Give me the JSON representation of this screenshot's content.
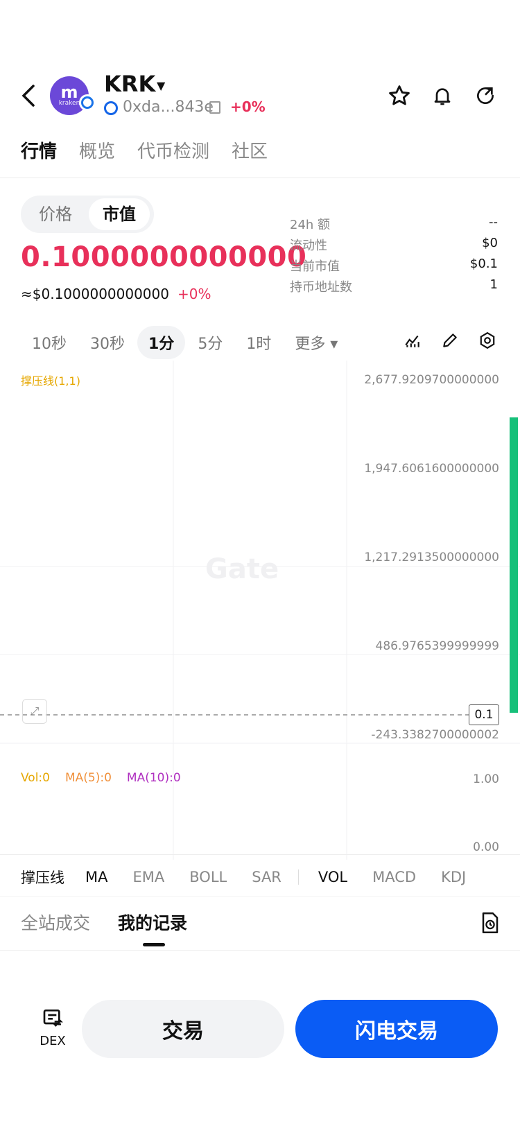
{
  "header": {
    "symbol": "KRK",
    "logo_text": "kraken",
    "address": "0xda...843e",
    "change": "+0%"
  },
  "tabs": [
    "行情",
    "概览",
    "代币检测",
    "社区"
  ],
  "toggle": {
    "price": "价格",
    "mcap": "市值"
  },
  "main": {
    "price": "0.1000000000000",
    "usd": "≈$0.1000000000000",
    "usd_change": "+0%"
  },
  "stats": [
    {
      "label": "24h  额",
      "value": "--"
    },
    {
      "label": "流动性",
      "value": "$0"
    },
    {
      "label": "当前市值",
      "value": "$0.1"
    },
    {
      "label": "持币地址数",
      "value": "1"
    }
  ],
  "intervals": [
    "10秒",
    "30秒",
    "1分",
    "5分",
    "1时",
    "更多 ▾"
  ],
  "chart_data": {
    "type": "line",
    "indicator": "撑压线(1,1)",
    "y_ticks": [
      "2,677.9209700000000",
      "1,947.6061600000000",
      "1,217.2913500000000",
      "486.9765399999999",
      "-243.3382700000002"
    ],
    "current_price_tag": "0.1",
    "watermark": "Gate",
    "volume": {
      "labels": [
        "Vol:0",
        "MA(5):0",
        "MA(10):0"
      ],
      "label_colors": [
        "#e6a700",
        "#f0903a",
        "#b030c0"
      ],
      "y_ticks": [
        "1.00",
        "0.00"
      ]
    }
  },
  "indicators": {
    "main": [
      "撑压线",
      "MA",
      "EMA",
      "BOLL",
      "SAR"
    ],
    "sub": [
      "VOL",
      "MACD",
      "KDJ"
    ]
  },
  "records": {
    "all": "全站成交",
    "mine": "我的记录"
  },
  "bottom": {
    "dex": "DEX",
    "trade": "交易",
    "flash": "闪电交易"
  }
}
